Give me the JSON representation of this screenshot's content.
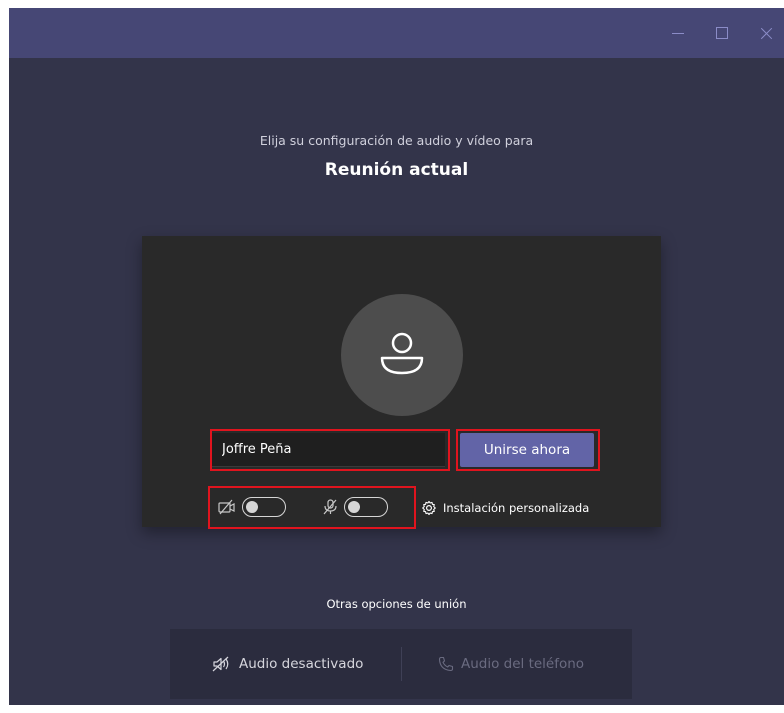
{
  "window": {
    "controls": [
      "minimize-icon",
      "maximize-icon",
      "close-icon"
    ]
  },
  "header": {
    "subtitle": "Elija su configuración de audio y vídeo para",
    "title": "Reunión actual"
  },
  "card": {
    "avatar_icon": "person-icon",
    "name_value": "Joffre Peña",
    "join_label": "Unirse ahora",
    "video_toggle_on": false,
    "mic_toggle_on": false,
    "custom_setup_label": "Instalación personalizada"
  },
  "other_options": {
    "label": "Otras opciones de unión",
    "audio_off_label": "Audio desactivado",
    "phone_audio_label": "Audio del teléfono"
  },
  "colors": {
    "titlebar": "#464775",
    "background": "#33344a",
    "card": "#292929",
    "accent": "#6264a7",
    "highlight": "#e0141e"
  }
}
